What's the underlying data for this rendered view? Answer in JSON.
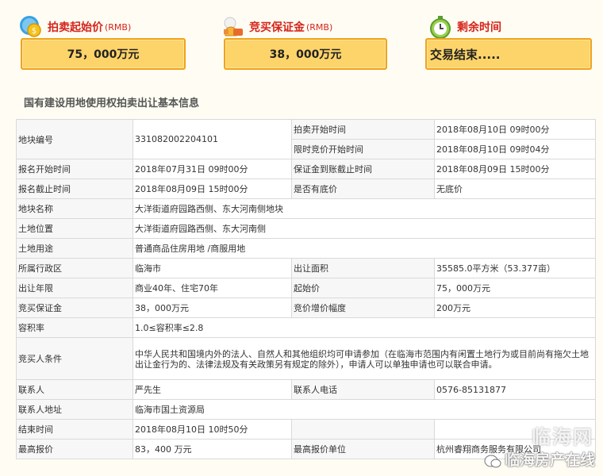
{
  "header": {
    "start_price": {
      "label": "拍卖起始价",
      "unit": "(RMB)",
      "value": "75，000万元",
      "icon": "coins-icon"
    },
    "deposit": {
      "label": "竞买保证金",
      "unit": "(RMB)",
      "value": "38，000万元",
      "icon": "moneybag-icon"
    },
    "remaining": {
      "label": "剩余时间",
      "value": "交易结束.....",
      "icon": "alarm-clock-icon"
    }
  },
  "section_title": "国有建设用地使用权拍卖出让基本信息",
  "rows": [
    {
      "a": "地块编号",
      "b": "331082002204101",
      "c1": "拍卖开始时间",
      "d1": "2018年08月10日 09时00分",
      "c2": "限时竞价开始时间",
      "d2": "2018年08月10日 09时04分"
    },
    {
      "a": "报名开始时间",
      "b": "2018年07月31日 09时00分",
      "c": "保证金到账截止时间",
      "d": "2018年08月09日 15时00分"
    },
    {
      "a": "报名截止时间",
      "b": "2018年08月09日 15时00分",
      "c": "是否有底价",
      "d": "无底价"
    },
    {
      "a": "地块名称",
      "b": "大洋街道府园路西侧、东大河南侧地块"
    },
    {
      "a": "土地位置",
      "b": "大洋街道府园路西侧、东大河南侧"
    },
    {
      "a": "土地用途",
      "b": "普通商品住房用地 /商服用地"
    },
    {
      "a": "所属行政区",
      "b": "临海市",
      "c": "出让面积",
      "d": "35585.0平方米（53.377亩）"
    },
    {
      "a": "出让年限",
      "b": "商业40年、住宅70年",
      "c": "起始价",
      "d": "75，000万元"
    },
    {
      "a": "竞买保证金",
      "b": "38，000万元",
      "c": "竞价增价幅度",
      "d": "200万元"
    },
    {
      "a": "容积率",
      "b": "1.0≤容积率≤2.8"
    },
    {
      "a": "竞买人条件",
      "b": "中华人民共和国境内外的法人、自然人和其他组织均可申请参加（在临海市范围内有闲置土地行为或目前尚有拖欠土地出让金行为的、法律法规及有关政策另有规定的除外），申请人可以单独申请也可以联合申请。"
    },
    {
      "a": "联系人",
      "b": "严先生",
      "c": "联系人电话",
      "d": "0576-85131877"
    },
    {
      "a": "联系人地址",
      "b": "临海市国土资源局"
    },
    {
      "a": "结束时间",
      "b": "2018年08月10日 10时50分",
      "c": "",
      "d": ""
    },
    {
      "a": "最高报价",
      "b": "83，400 万元",
      "c": "最高报价单位",
      "d": "杭州睿翔商务服务有限公司"
    }
  ],
  "watermark": {
    "text": "临海房产在线",
    "bg_text": "临海网"
  },
  "colors": {
    "accent_red": "#d5241b",
    "box_fill": "#fdd46a",
    "box_border": "#f0a31c"
  }
}
